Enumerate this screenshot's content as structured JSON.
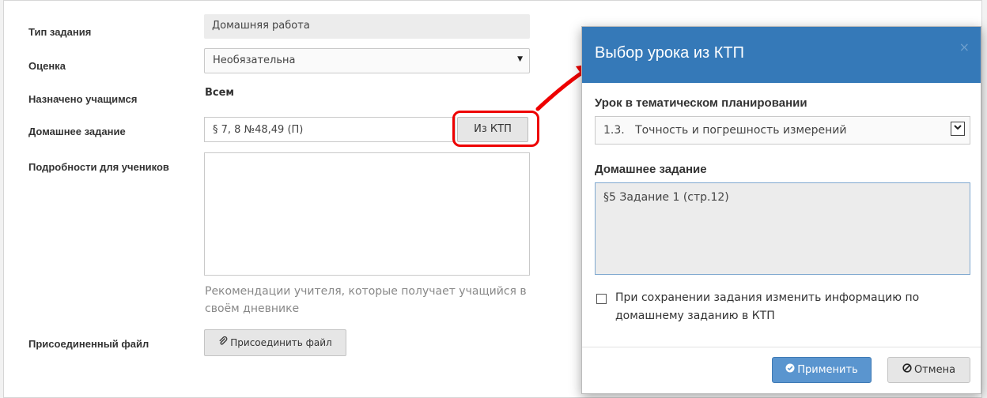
{
  "form": {
    "task_type": {
      "label": "Тип задания",
      "value": "Домашняя работа"
    },
    "grade": {
      "label": "Оценка",
      "selected": "Необязательна"
    },
    "assigned": {
      "label": "Назначено учащимся",
      "value": "Всем"
    },
    "homework": {
      "label": "Домашнее задание",
      "value": "§ 7, 8 №48,49 (П)",
      "ktp_button": "Из КТП"
    },
    "details": {
      "label": "Подробности для учеников",
      "value": "",
      "hint": "Рекомендации учителя, которые получает учащийся в своём дневнике"
    },
    "attachment": {
      "label": "Присоединенный файл",
      "button": "Присоединить файл"
    }
  },
  "modal": {
    "title": "Выбор урока из КТП",
    "close_glyph": "×",
    "lesson": {
      "label": "Урок в тематическом планировании",
      "selected": "1.3.   Точность и погрешность измерений"
    },
    "homework": {
      "label": "Домашнее задание",
      "value": "§5 Задание 1 (стр.12)"
    },
    "update_checkbox": {
      "checked": false,
      "label": "При сохранении задания изменить информацию по домашнему заданию в КТП"
    },
    "apply_button": "Применить",
    "cancel_button": "Отмена"
  },
  "colors": {
    "modal_header": "#3579b8",
    "apply_button": "#5a95cf",
    "highlight": "#e00000"
  },
  "icons": {
    "select_caret": "caret-down-icon",
    "attach": "paperclip-icon",
    "apply": "check-circle-icon",
    "cancel": "ban-icon",
    "close": "close-icon",
    "annotation": "red-arrow-icon"
  }
}
